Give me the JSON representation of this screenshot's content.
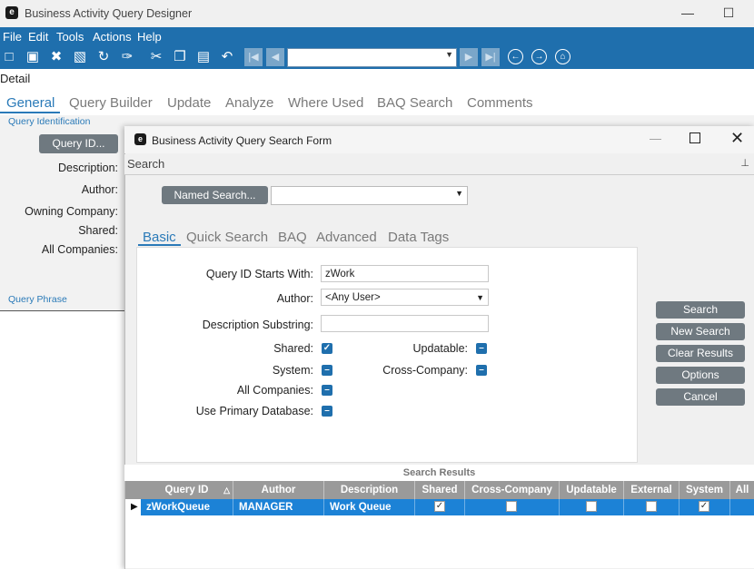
{
  "app": {
    "title": "Business Activity Query Designer",
    "logo_letter": "e"
  },
  "window_controls": {
    "minimize": "—",
    "maximize": "☐"
  },
  "menu": [
    "File",
    "Edit",
    "Tools",
    "Actions",
    "Help"
  ],
  "detail_label": "Detail",
  "tabs": [
    "General",
    "Query Builder",
    "Update",
    "Analyze",
    "Where Used",
    "BAQ Search",
    "Comments"
  ],
  "general": {
    "group_query_identification": "Query Identification",
    "query_id_button": "Query ID...",
    "labels": {
      "description": "Description:",
      "author": "Author:",
      "owning_company": "Owning Company:",
      "shared": "Shared:",
      "all_companies": "All Companies:"
    },
    "group_query_phrase": "Query Phrase"
  },
  "dialog": {
    "title": "Business Activity Query Search Form",
    "logo_letter": "e",
    "search_bar_label": "Search",
    "named_search_button": "Named Search...",
    "named_search_value": "",
    "tabs": [
      "Basic",
      "Quick Search",
      "BAQ",
      "Advanced",
      "Data Tags"
    ],
    "basic": {
      "query_id_starts_with_label": "Query ID Starts With:",
      "query_id_starts_with_value": "zWork",
      "author_label": "Author:",
      "author_value": "<Any User>",
      "description_substring_label": "Description Substring:",
      "description_substring_value": "",
      "shared_label": "Shared:",
      "updatable_label": "Updatable:",
      "system_label": "System:",
      "cross_company_label": "Cross-Company:",
      "all_companies_label": "All Companies:",
      "use_primary_db_label": "Use Primary Database:",
      "shared_state": "checked",
      "updatable_state": "indeterminate",
      "system_state": "indeterminate",
      "cross_company_state": "indeterminate",
      "all_companies_state": "indeterminate",
      "use_primary_db_state": "indeterminate"
    },
    "buttons": [
      "Search",
      "New Search",
      "Clear Results",
      "Options",
      "Cancel"
    ],
    "results": {
      "header": "Search Results",
      "columns": [
        "Query ID",
        "Author",
        "Description",
        "Shared",
        "Cross-Company",
        "Updatable",
        "External",
        "System",
        "All"
      ],
      "rows": [
        {
          "query_id": "zWorkQueue",
          "author": "MANAGER",
          "description": "Work Queue",
          "shared": true,
          "cross_company": false,
          "updatable": false,
          "external": false,
          "system": true
        }
      ]
    }
  },
  "colors": {
    "accent": "#1f6fad",
    "tab_active": "#2a7ab8",
    "button": "#6f7980",
    "row_selected": "#1c82d6"
  }
}
